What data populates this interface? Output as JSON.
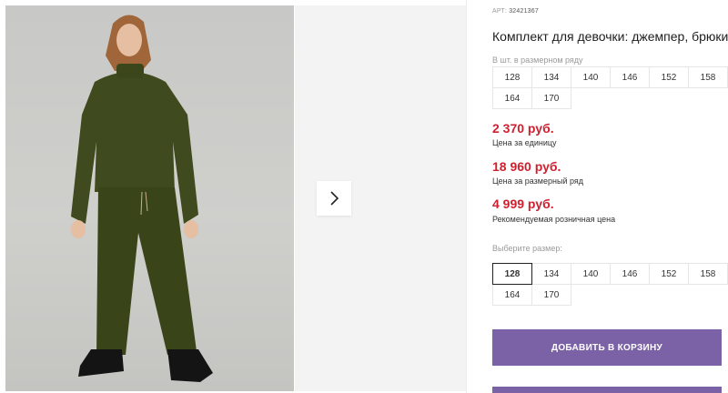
{
  "product": {
    "sku_label": "АРТ:",
    "sku_value": "32421367",
    "title": "Комплект для девочки: джемпер, брюки"
  },
  "size_run": {
    "label": "В шт. в размерном ряду",
    "sizes": [
      "128",
      "134",
      "140",
      "146",
      "152",
      "158",
      "164",
      "170"
    ]
  },
  "prices": [
    {
      "value": "2 370 руб.",
      "note": "Цена за единицу"
    },
    {
      "value": "18 960 руб.",
      "note": "Цена за размерный ряд"
    },
    {
      "value": "4 999 руб.",
      "note": "Рекомендуемая розничная цена"
    }
  ],
  "size_select": {
    "label": "Выберите размер:",
    "sizes": [
      "128",
      "134",
      "140",
      "146",
      "152",
      "158",
      "164",
      "170"
    ],
    "selected": "128"
  },
  "actions": {
    "add_to_cart": "ДОБАВИТЬ В КОРЗИНУ"
  },
  "colors": {
    "accent": "#7b62a6",
    "price": "#d0202f",
    "garment": "#3f4a1e"
  },
  "icons": {
    "next": "chevron-right-icon"
  }
}
